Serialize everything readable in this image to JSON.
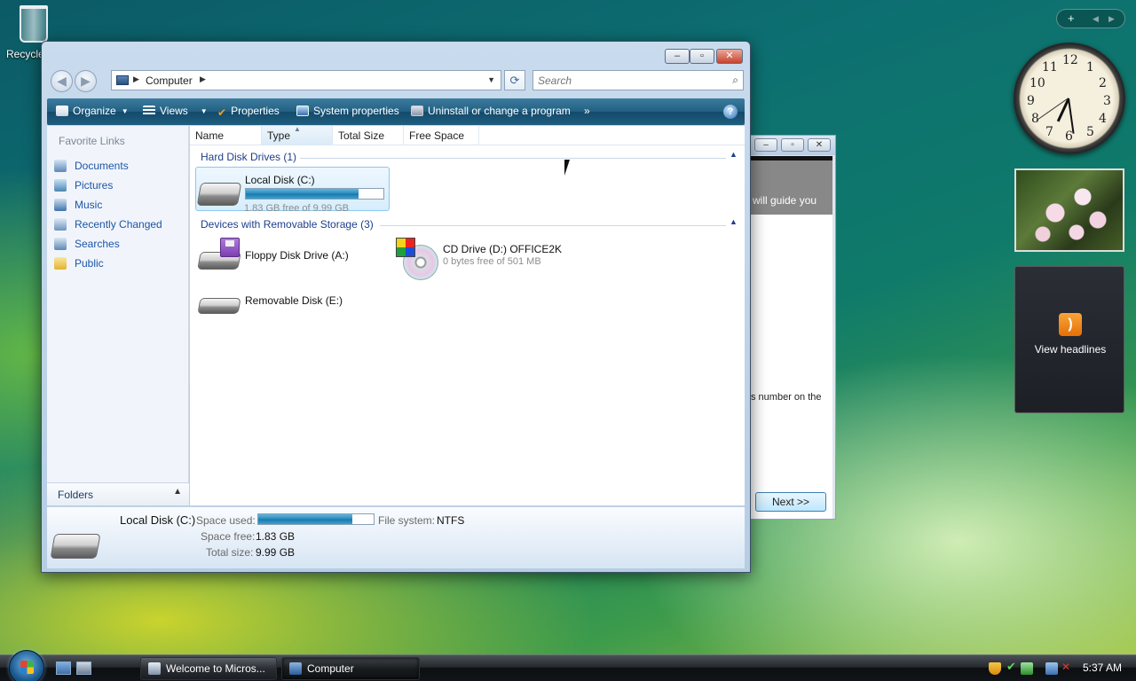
{
  "desktop": {
    "recycle_bin_label": "Recycle"
  },
  "gadgets": {
    "controls": {
      "add": "+",
      "prev": "◀",
      "next": "▶"
    },
    "clock_numbers": [
      "12",
      "1",
      "2",
      "3",
      "4",
      "5",
      "6",
      "7",
      "8",
      "9",
      "10",
      "11"
    ],
    "feed_label": "View headlines"
  },
  "wizard": {
    "partial_text_1": "will guide you",
    "partial_text_2": "s number on the",
    "next_button": "Next >>"
  },
  "explorer": {
    "address": {
      "crumb": "Computer"
    },
    "search": {
      "placeholder": "Search"
    },
    "toolbar": {
      "organize": "Organize",
      "views": "Views",
      "properties": "Properties",
      "system_properties": "System properties",
      "uninstall": "Uninstall or change a program",
      "more": "»"
    },
    "nav_pane": {
      "header": "Favorite Links",
      "items": [
        "Documents",
        "Pictures",
        "Music",
        "Recently Changed",
        "Searches",
        "Public"
      ],
      "folders_label": "Folders"
    },
    "columns": [
      "Name",
      "Type",
      "Total Size",
      "Free Space"
    ],
    "groups": {
      "hard_disks": "Hard Disk Drives (1)",
      "removable": "Devices with Removable Storage (3)"
    },
    "drives": {
      "c": {
        "name": "Local Disk (C:)",
        "free_text": "1.83 GB free of 9.99 GB",
        "used_fraction": 0.817
      },
      "a": {
        "name": "Floppy Disk Drive (A:)"
      },
      "d": {
        "name": "CD Drive (D:) OFFICE2K",
        "free_text": "0 bytes free of 501 MB"
      },
      "e": {
        "name": "Removable Disk (E:)"
      }
    },
    "details": {
      "title": "Local Disk (C:)",
      "space_used_label": "Space used:",
      "file_system_label": "File system:",
      "file_system_value": "NTFS",
      "space_free_label": "Space free:",
      "space_free_value": "1.83 GB",
      "total_size_label": "Total size:",
      "total_size_value": "9.99 GB"
    }
  },
  "taskbar": {
    "tasks": [
      "Welcome to Micros...",
      "Computer"
    ],
    "time": "5:37 AM"
  },
  "colors": {
    "toolbar": "#1f5e7f",
    "link": "#1d55a6",
    "group_header": "#1e3e8c",
    "progress": "#2a88bd"
  }
}
